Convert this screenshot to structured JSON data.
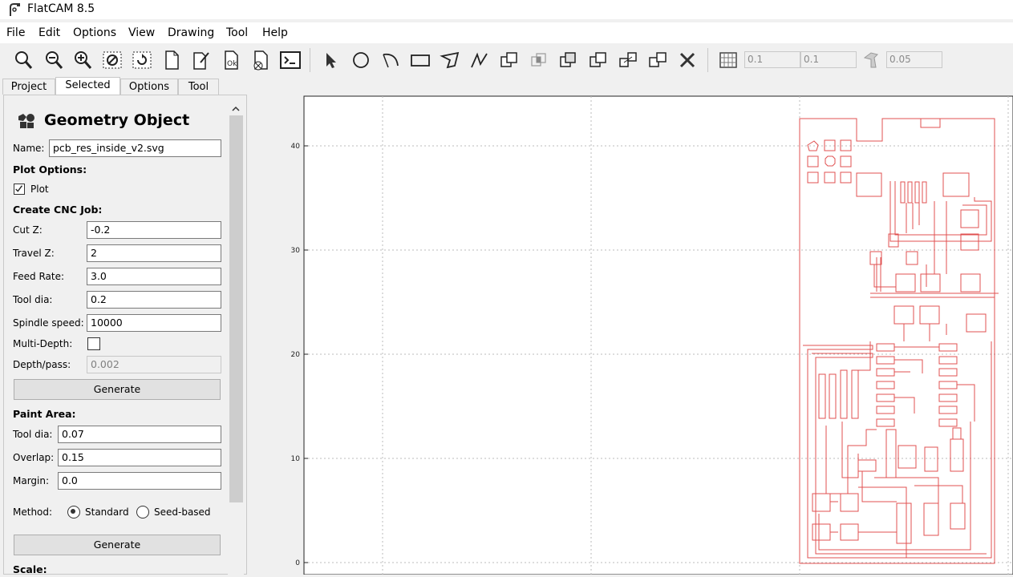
{
  "window": {
    "title": "FlatCAM 8.5"
  },
  "menu": [
    "File",
    "Edit",
    "Options",
    "View",
    "Drawing",
    "Tool",
    "Help"
  ],
  "toolbar": {
    "grid_x": "0.1",
    "grid_y": "0.1",
    "snap_max": "0.05"
  },
  "tabs": [
    {
      "label": "Project",
      "active": false
    },
    {
      "label": "Selected",
      "active": true
    },
    {
      "label": "Options",
      "active": false
    },
    {
      "label": "Tool",
      "active": false
    }
  ],
  "panel": {
    "header": "Geometry Object",
    "name_label": "Name:",
    "name_value": "pcb_res_inside_v2.svg",
    "plot_options_label": "Plot Options:",
    "plot_label": "Plot",
    "plot_checked": true,
    "cnc_label": "Create CNC Job:",
    "cut_z_label": "Cut Z:",
    "cut_z": "-0.2",
    "travel_z_label": "Travel Z:",
    "travel_z": "2",
    "feed_rate_label": "Feed Rate:",
    "feed_rate": "3.0",
    "tool_dia_label": "Tool dia:",
    "tool_dia": "0.2",
    "spindle_label": "Spindle speed:",
    "spindle": "10000",
    "multidepth_label": "Multi-Depth:",
    "multidepth_checked": false,
    "depthpass_label": "Depth/pass:",
    "depthpass": "0.002",
    "generate_label": "Generate",
    "paint_label": "Paint Area:",
    "paint_tool_dia_label": "Tool dia:",
    "paint_tool_dia": "0.07",
    "overlap_label": "Overlap:",
    "overlap": "0.15",
    "margin_label": "Margin:",
    "margin": "0.0",
    "method_label": "Method:",
    "method_standard": "Standard",
    "method_seed": "Seed-based",
    "method_selected": "Standard",
    "generate2_label": "Generate",
    "scale_label": "Scale:"
  },
  "plot": {
    "y_ticks": [
      "40",
      "30",
      "20",
      "10",
      "0"
    ],
    "trace_color": "#e05050",
    "grid_color": "#bbbbbb"
  }
}
